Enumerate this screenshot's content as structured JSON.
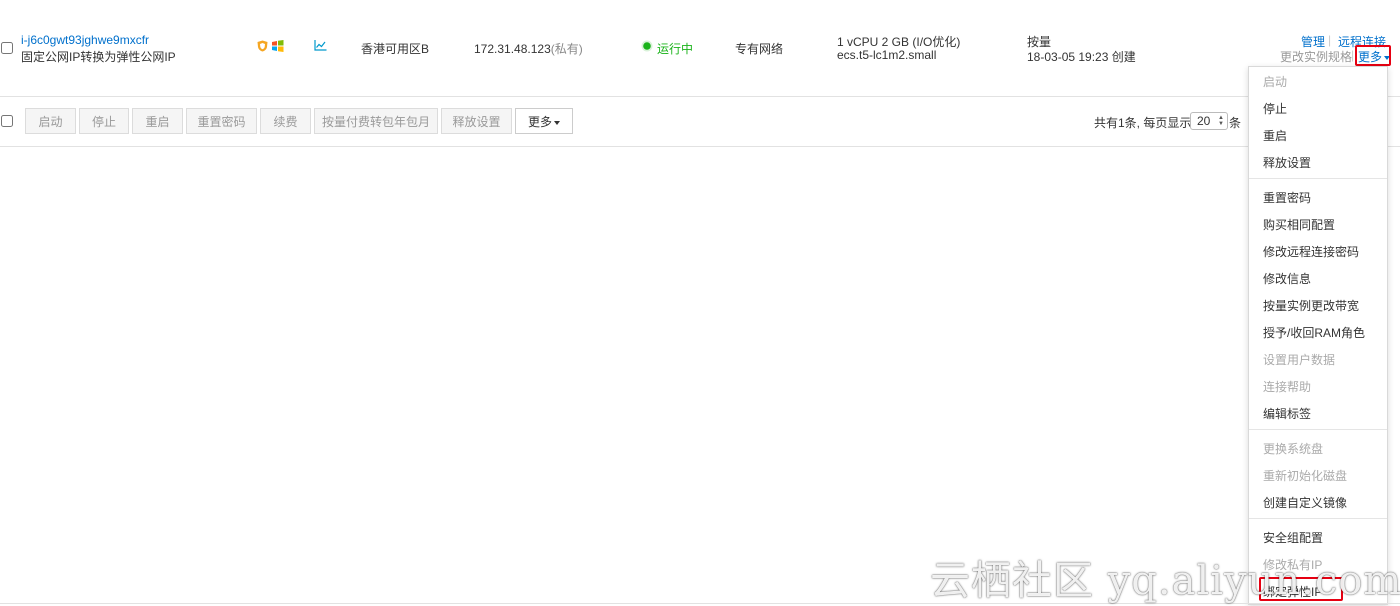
{
  "instance": {
    "id": "i-j6c0gwt93jghwe9mxcfr",
    "description": "固定公网IP转换为弹性公网IP",
    "zone": "香港可用区B",
    "ip_address": "172.31.48.123",
    "ip_suffix": "(私有)",
    "status": "运行中",
    "network": "专有网络",
    "spec_line1": "1 vCPU 2 GB (I/O优化)",
    "spec_line2": "ecs.t5-lc1m2.small",
    "billing": "按量",
    "created": "18-03-05 19:23 创建",
    "actions": {
      "manage": "管理",
      "separator": "|",
      "remote": "远程连接",
      "change_spec": "更改实例规格",
      "more": "更多"
    }
  },
  "toolbar": {
    "buttons": [
      "启动",
      "停止",
      "重启",
      "重置密码",
      "续费",
      "按量付费转包年包月",
      "释放设置"
    ],
    "more": "更多"
  },
  "pagination": {
    "total_text": "共有1条, 每页显示:",
    "page_size": "20",
    "unit": "条"
  },
  "menu": {
    "items": [
      {
        "label": "启动",
        "disabled": true
      },
      {
        "label": "停止",
        "disabled": false
      },
      {
        "label": "重启",
        "disabled": false
      },
      {
        "label": "释放设置",
        "disabled": false
      },
      {
        "label": "重置密码",
        "disabled": false
      },
      {
        "label": "购买相同配置",
        "disabled": false
      },
      {
        "label": "修改远程连接密码",
        "disabled": false
      },
      {
        "label": "修改信息",
        "disabled": false
      },
      {
        "label": "按量实例更改带宽",
        "disabled": false
      },
      {
        "label": "授予/收回RAM角色",
        "disabled": false
      },
      {
        "label": "设置用户数据",
        "disabled": true
      },
      {
        "label": "连接帮助",
        "disabled": true
      },
      {
        "label": "编辑标签",
        "disabled": false
      },
      {
        "label": "更换系统盘",
        "disabled": true
      },
      {
        "label": "重新初始化磁盘",
        "disabled": true
      },
      {
        "label": "创建自定义镜像",
        "disabled": false
      },
      {
        "label": "安全组配置",
        "disabled": false
      },
      {
        "label": "修改私有IP",
        "disabled": true
      },
      {
        "label": "绑定弹性IP",
        "disabled": false
      }
    ]
  },
  "watermark": "云栖社区 yq.aliyun.com",
  "colors": {
    "link": "#0070cc",
    "status_green": "#1ab31a",
    "highlight_red": "#e60012",
    "shield_orange": "#f5a623"
  },
  "icons": [
    "shield-icon",
    "windows-icon",
    "monitor-chart-icon",
    "status-running-icon",
    "caret-down-icon"
  ]
}
